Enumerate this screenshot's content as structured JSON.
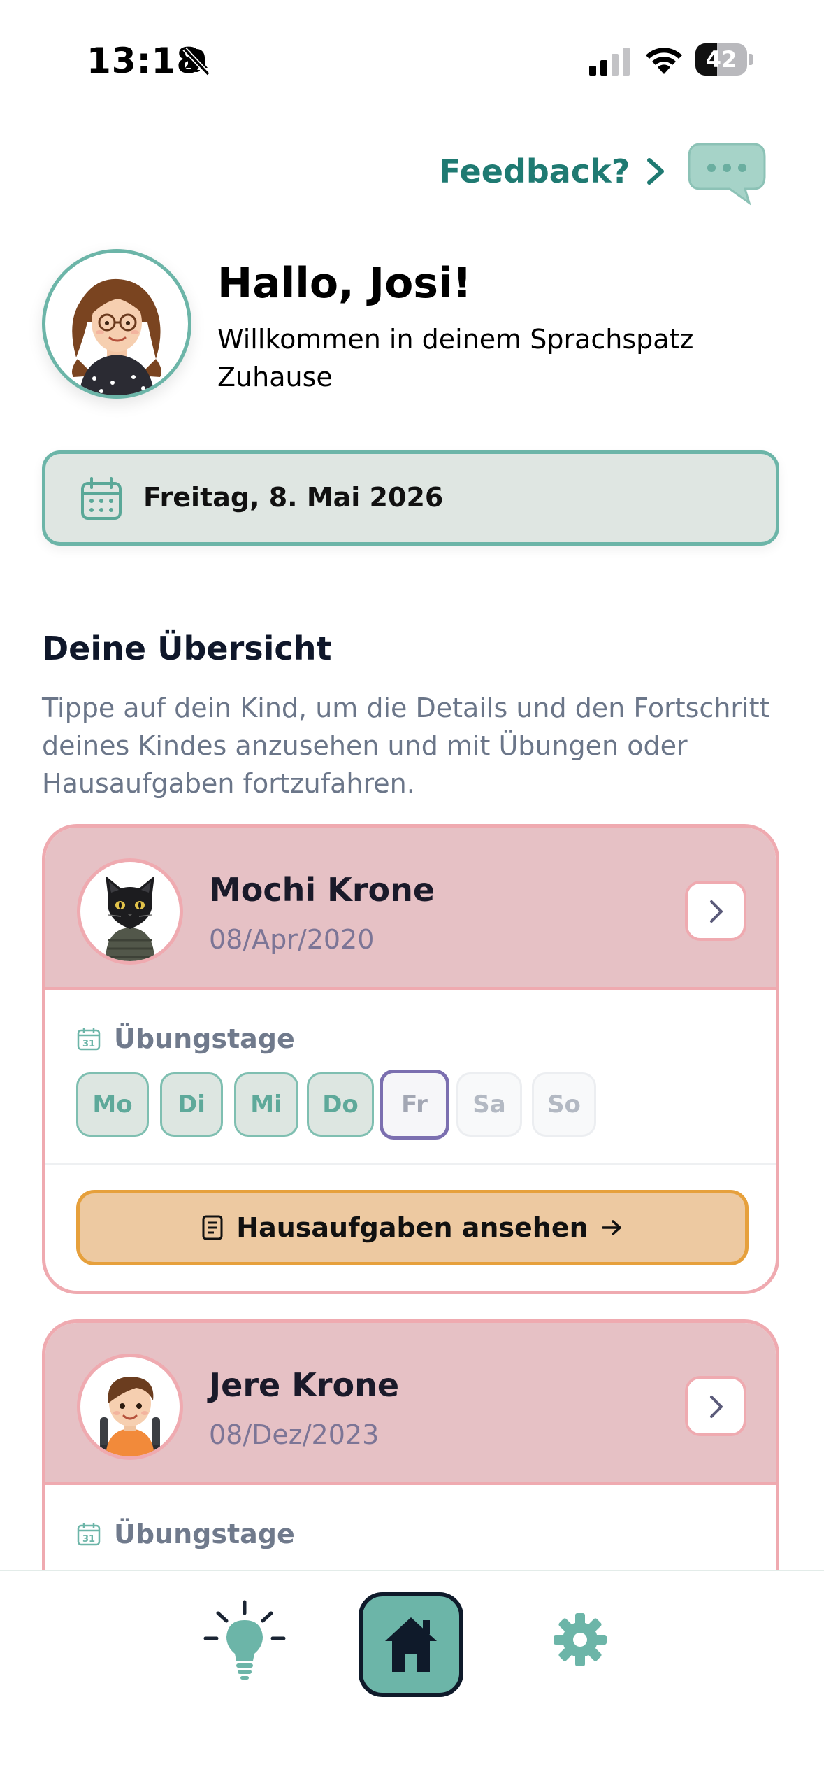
{
  "status_bar": {
    "time": "13:18",
    "battery_percent": 42,
    "icons": [
      "bell-muted-icon",
      "signal-icon",
      "wifi-icon",
      "battery-icon"
    ]
  },
  "feedback": {
    "label": "Feedback?",
    "icon": "chat-bubble-icon"
  },
  "greeting": {
    "title": "Hallo, Josi!",
    "subtitle": "Willkommen in deinem Sprachspatz Zuhause"
  },
  "date_banner": {
    "icon": "calendar-icon",
    "text": "Freitag, 8. Mai 2026"
  },
  "overview": {
    "title": "Deine Übersicht",
    "description": "Tippe auf dein Kind, um die Details und den Fortschritt deines Kindes anzusehen und mit Übungen oder Hausaufgaben fortzufahren."
  },
  "children": [
    {
      "name": "Mochi Krone",
      "birthdate": "08/Apr/2020",
      "practice_label": "Übungstage",
      "days": [
        {
          "label": "Mo",
          "state": "active"
        },
        {
          "label": "Di",
          "state": "active"
        },
        {
          "label": "Mi",
          "state": "active"
        },
        {
          "label": "Do",
          "state": "active"
        },
        {
          "label": "Fr",
          "state": "today"
        },
        {
          "label": "Sa",
          "state": "inactive"
        },
        {
          "label": "So",
          "state": "inactive"
        }
      ],
      "homework_button": "Hausaufgaben ansehen"
    },
    {
      "name": "Jere Krone",
      "birthdate": "08/Dez/2023",
      "practice_label": "Übungstage"
    }
  ],
  "colors": {
    "accent_teal": "#6cb5a8",
    "feedback_teal": "#1f7a72",
    "card_pink": "#e6c1c5",
    "card_border": "#efaab0",
    "homework_orange": "#edc9a1",
    "today_purple": "#7b6fb0"
  },
  "bottom_nav": {
    "items": [
      "lightbulb-icon",
      "home-icon",
      "settings-icon"
    ],
    "active": "home-icon"
  }
}
